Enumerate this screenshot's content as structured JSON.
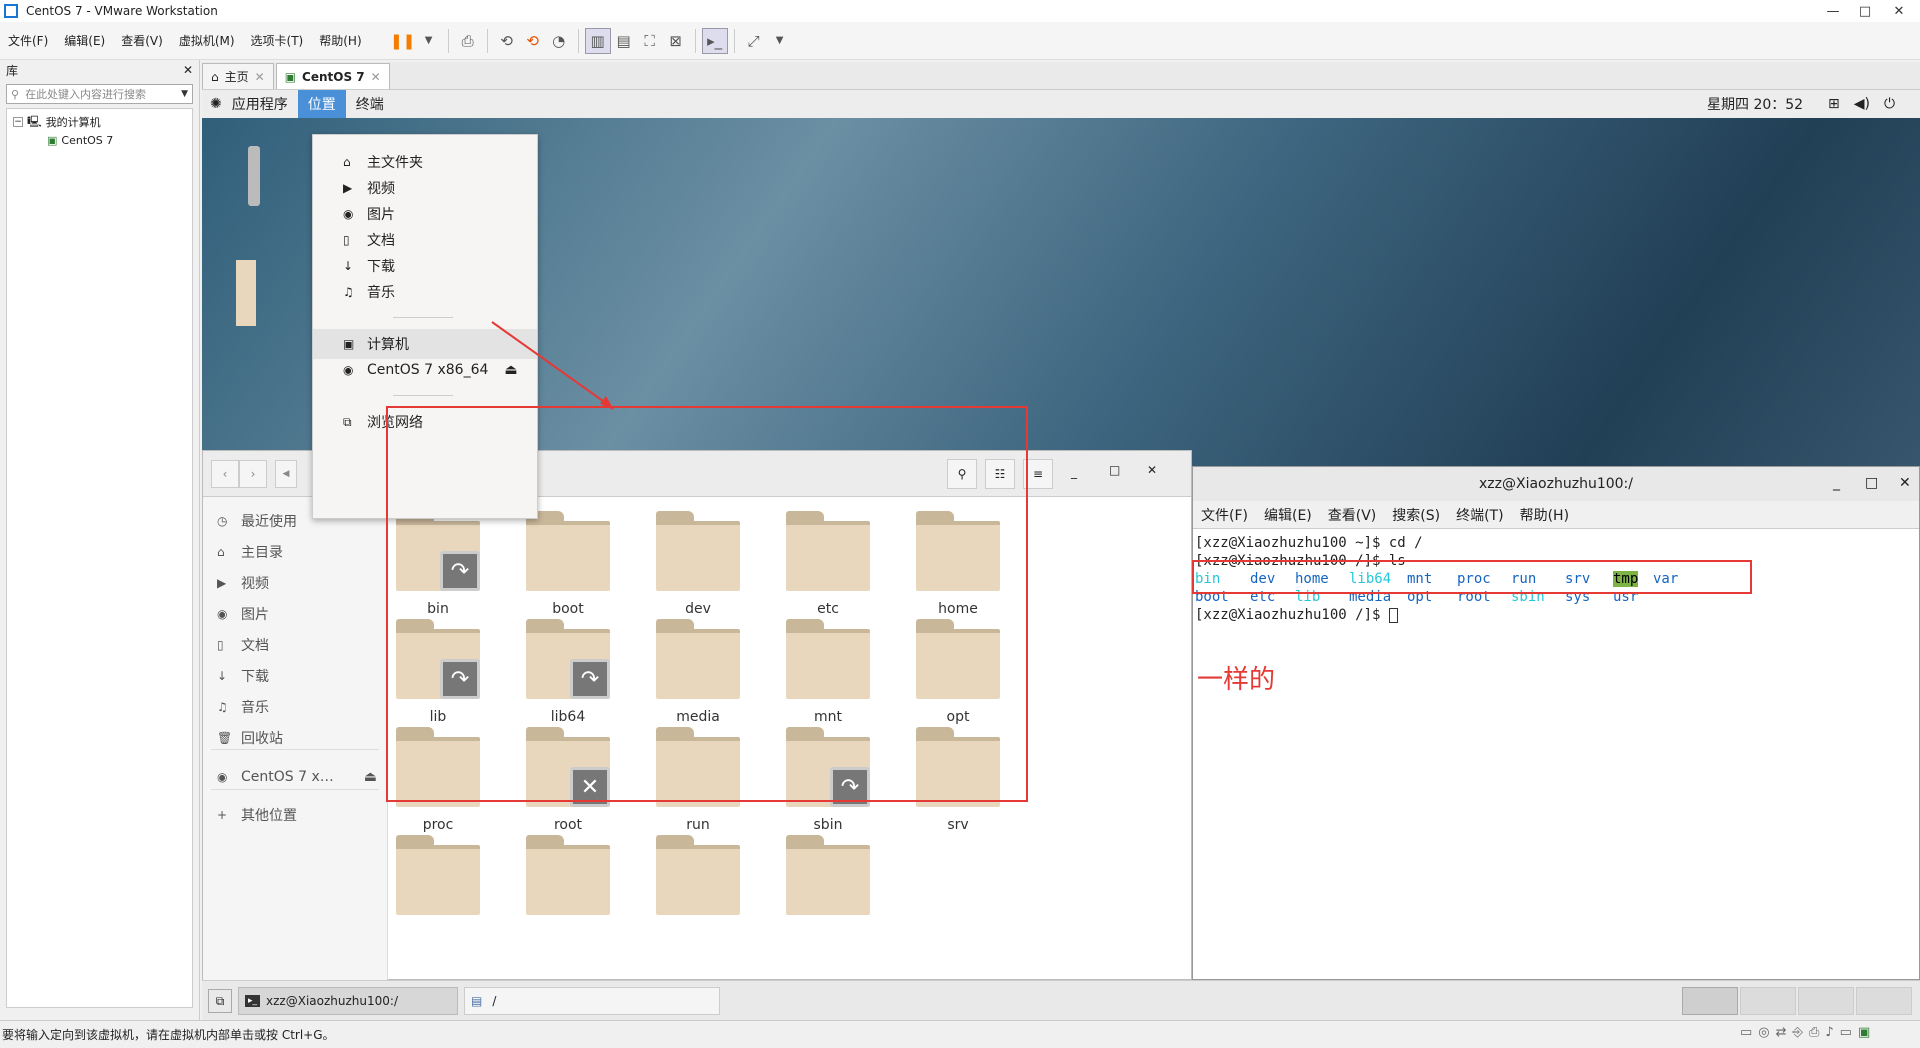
{
  "window": {
    "title": "CentOS 7 - VMware Workstation"
  },
  "menu": [
    "文件(F)",
    "编辑(E)",
    "查看(V)",
    "虚拟机(M)",
    "选项卡(T)",
    "帮助(H)"
  ],
  "library": {
    "title": "库",
    "search_placeholder": "在此处键入内容进行搜索",
    "tree": [
      "我的计算机",
      "CentOS 7"
    ]
  },
  "tabs": [
    "主页",
    "CentOS 7"
  ],
  "gnome": {
    "apps": "应用程序",
    "places": "位置",
    "terminal": "终端",
    "clock": "星期四 20：52"
  },
  "places_menu": {
    "items": [
      "主文件夹",
      "视频",
      "图片",
      "文档",
      "下载",
      "音乐"
    ],
    "computer": "计算机",
    "disc": "CentOS 7 x86_64",
    "network": "浏览网络"
  },
  "files_sidebar": [
    "最近使用",
    "主目录",
    "视频",
    "图片",
    "文档",
    "下载",
    "音乐",
    "回收站",
    "CentOS 7 x…",
    "其他位置"
  ],
  "folders": [
    {
      "name": "bin",
      "emblem": "link"
    },
    {
      "name": "boot",
      "emblem": ""
    },
    {
      "name": "dev",
      "emblem": ""
    },
    {
      "name": "etc",
      "emblem": ""
    },
    {
      "name": "home",
      "emblem": ""
    },
    {
      "name": "lib",
      "emblem": "link"
    },
    {
      "name": "lib64",
      "emblem": "link"
    },
    {
      "name": "media",
      "emblem": ""
    },
    {
      "name": "mnt",
      "emblem": ""
    },
    {
      "name": "opt",
      "emblem": ""
    },
    {
      "name": "proc",
      "emblem": ""
    },
    {
      "name": "root",
      "emblem": "x"
    },
    {
      "name": "run",
      "emblem": ""
    },
    {
      "name": "sbin",
      "emblem": "link"
    },
    {
      "name": "srv",
      "emblem": ""
    },
    {
      "name": "",
      "emblem": ""
    },
    {
      "name": "",
      "emblem": ""
    },
    {
      "name": "",
      "emblem": ""
    },
    {
      "name": "",
      "emblem": ""
    }
  ],
  "terminal": {
    "title": "xzz@Xiaozhuzhu100:/",
    "menu": [
      "文件(F)",
      "编辑(E)",
      "查看(V)",
      "搜索(S)",
      "终端(T)",
      "帮助(H)"
    ],
    "lines": [
      "[xzz@Xiaozhuzhu100 ~]$ cd /",
      "[xzz@Xiaozhuzhu100 /]$ ls"
    ],
    "prompt": "[xzz@Xiaozhuzhu100 /]$ ",
    "ls_row1": [
      {
        "t": "bin",
        "c": "#26c6da"
      },
      {
        "t": "dev",
        "c": "#1565c0"
      },
      {
        "t": "home",
        "c": "#1565c0"
      },
      {
        "t": "lib64",
        "c": "#26c6da"
      },
      {
        "t": "mnt",
        "c": "#1565c0"
      },
      {
        "t": "proc",
        "c": "#1565c0"
      },
      {
        "t": "run",
        "c": "#1565c0"
      },
      {
        "t": "srv",
        "c": "#1565c0"
      },
      {
        "t": "tmp",
        "c": "#000000"
      },
      {
        "t": "var",
        "c": "#1565c0"
      }
    ],
    "ls_row2": [
      {
        "t": "boot",
        "c": "#1565c0"
      },
      {
        "t": "etc",
        "c": "#1565c0"
      },
      {
        "t": "lib",
        "c": "#26c6da"
      },
      {
        "t": "media",
        "c": "#1565c0"
      },
      {
        "t": "opt",
        "c": "#1565c0"
      },
      {
        "t": "root",
        "c": "#1565c0"
      },
      {
        "t": "sbin",
        "c": "#26c6da"
      },
      {
        "t": "sys",
        "c": "#1565c0"
      },
      {
        "t": "usr",
        "c": "#1565c0"
      }
    ]
  },
  "annotation": "一样的",
  "taskbar": {
    "terminal": "xzz@Xiaozhuzhu100:/",
    "files": "/"
  },
  "status": "要将输入定向到该虚拟机，请在虚拟机内部单击或按 Ctrl+G。"
}
